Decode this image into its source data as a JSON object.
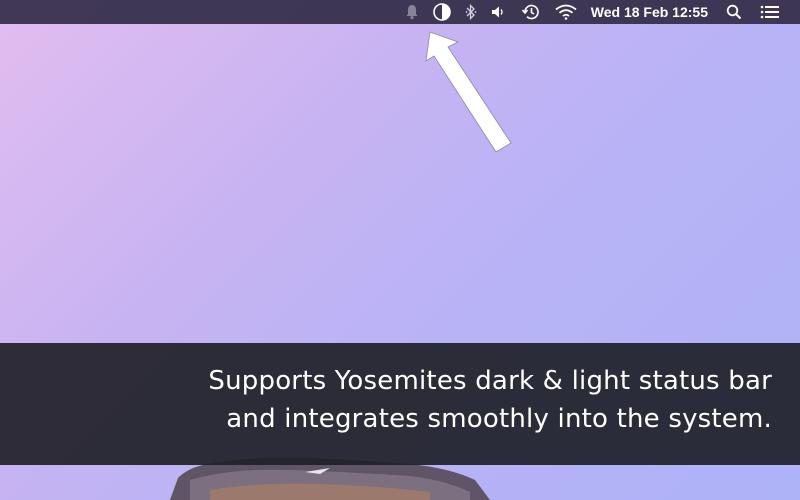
{
  "menubar": {
    "icons": [
      "bell-icon",
      "contrast-icon",
      "bluetooth-icon",
      "volume-icon",
      "time-machine-icon",
      "wifi-icon",
      "search-icon",
      "list-icon"
    ],
    "clock": "Wed 18 Feb  12:55"
  },
  "caption": {
    "line1": "Supports Yosemites dark & light status bar",
    "line2": "and integrates smoothly into the system."
  },
  "colors": {
    "background_top_left": "#e2bdf0",
    "background_bottom_right": "#aeb2f7",
    "menubar": "#322d46",
    "caption_band": "#202128",
    "arrow": "#ffffff"
  }
}
